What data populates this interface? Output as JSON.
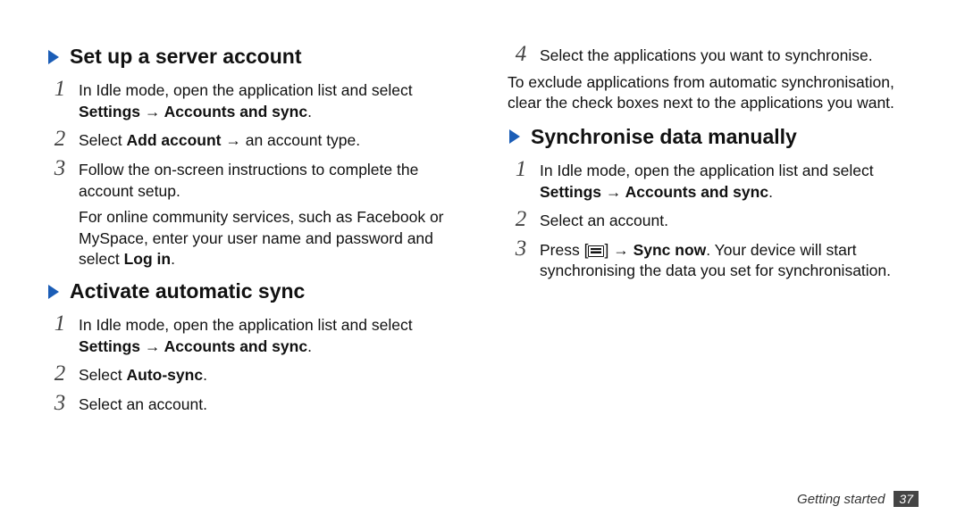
{
  "left": {
    "sectA": {
      "title": "Set up a server account",
      "steps": [
        {
          "n": "1",
          "text": "In Idle mode, open the application list and select ",
          "bold": "Settings → Accounts and sync",
          "tail": "."
        },
        {
          "n": "2",
          "pre": "Select ",
          "bold": "Add account",
          "tail": " → an account type."
        },
        {
          "n": "3",
          "text": "Follow the on-screen instructions to complete the account setup."
        }
      ],
      "note": {
        "pre": "For online community services, such as Facebook or MySpace, enter your user name and password and select ",
        "bold": "Log in",
        "tail": "."
      }
    },
    "sectB": {
      "title": "Activate automatic sync",
      "steps": [
        {
          "n": "1",
          "text": "In Idle mode, open the application list and select ",
          "bold": "Settings → Accounts and sync",
          "tail": "."
        },
        {
          "n": "2",
          "pre": "Select ",
          "bold": "Auto-sync",
          "tail": "."
        },
        {
          "n": "3",
          "text": "Select an account."
        }
      ]
    }
  },
  "right": {
    "cont_step": {
      "n": "4",
      "text": "Select the applications you want to synchronise."
    },
    "cont_note": "To exclude applications from automatic synchronisation, clear the check boxes next to the applications you want.",
    "sectC": {
      "title": "Synchronise data manually",
      "steps": [
        {
          "n": "1",
          "text": "In Idle mode, open the application list and select ",
          "bold": "Settings → Accounts and sync",
          "tail": "."
        },
        {
          "n": "2",
          "text": "Select an account."
        },
        {
          "n": "3",
          "pre": "Press [",
          "post_icon": "] → ",
          "bold": "Sync now",
          "tail": ". Your device will start synchronising the data you set for synchronisation."
        }
      ]
    }
  },
  "footer": {
    "section": "Getting started",
    "page": "37"
  }
}
